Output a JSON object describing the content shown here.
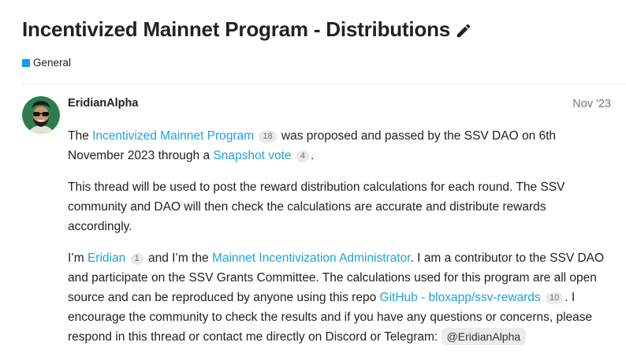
{
  "topic": {
    "title": "Incentivized Mainnet Program - Distributions",
    "category": "General",
    "category_color": "#0e9fe8"
  },
  "post": {
    "author": "EridianAlpha",
    "date": "Nov '23",
    "p1": {
      "t1": "The ",
      "link1": "Incentivized Mainnet Program",
      "badge1": "18",
      "t2": " was proposed and passed by the SSV DAO on 6th November 2023 through a ",
      "link2": "Snapshot vote",
      "badge2": "4",
      "t3": "."
    },
    "p2": "This thread will be used to post the reward distribution calculations for each round. The SSV community and DAO will then check the calculations are accurate and distribute rewards accordingly.",
    "p3": {
      "t1": "I’m ",
      "link1": "Eridian",
      "badge1": "1",
      "t2": " and I’m the ",
      "link2": "Mainnet Incentivization Administrator",
      "t3": ". I am a contributor to the SSV DAO and participate on the SSV Grants Committee. The calculations used for this program are all open source and can be reproduced by anyone using this repo ",
      "link3": "GitHub - bloxapp/ssv-rewards",
      "badge3": "10",
      "t4": ". I encourage the community to check the results and if you have any questions or concerns, please respond in this thread or contact me directly on Discord or Telegram: ",
      "mention": "@EridianAlpha"
    }
  },
  "icons": {
    "edit": "pencil-icon",
    "category": "category-square-icon",
    "avatar": "avatar-bearded-sunglasses"
  },
  "colors": {
    "link": "#1ea3dd",
    "text": "#222222",
    "muted": "#737373"
  }
}
